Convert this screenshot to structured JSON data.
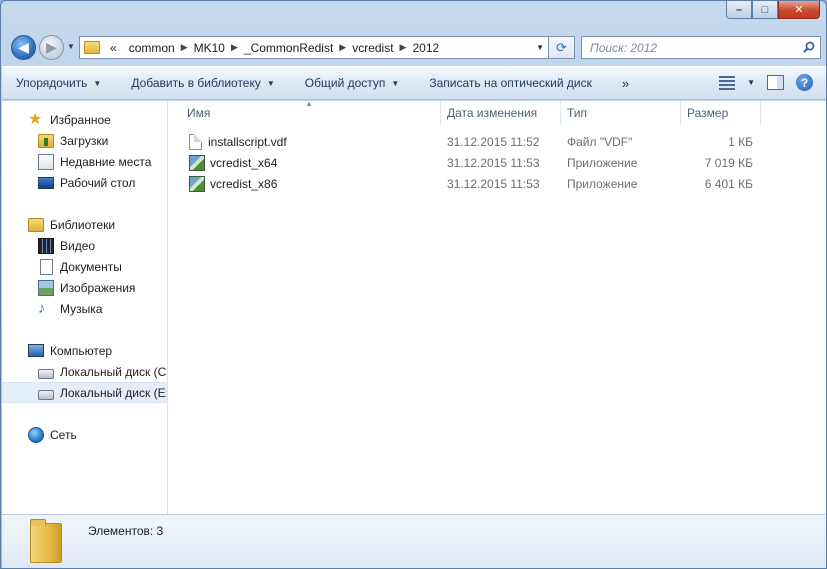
{
  "window": {
    "caption_buttons": {
      "minimize": "–",
      "maximize": "□",
      "close": "✕"
    }
  },
  "address_bar": {
    "overflow": "«",
    "crumbs": [
      "common",
      "MK10",
      "_CommonRedist",
      "vcredist",
      "2012"
    ]
  },
  "search": {
    "placeholder": "Поиск: 2012"
  },
  "toolbar": {
    "organize": "Упорядочить",
    "add_to_library": "Добавить в библиотеку",
    "share": "Общий доступ",
    "burn": "Записать на оптический диск",
    "more": "»",
    "help": "?"
  },
  "nav_pane": {
    "favorites": {
      "label": "Избранное",
      "items": [
        "Загрузки",
        "Недавние места",
        "Рабочий стол"
      ]
    },
    "libraries": {
      "label": "Библиотеки",
      "items": [
        "Видео",
        "Документы",
        "Изображения",
        "Музыка"
      ]
    },
    "computer": {
      "label": "Компьютер",
      "items": [
        "Локальный диск (C:)",
        "Локальный диск (E:)"
      ]
    },
    "network": {
      "label": "Сеть"
    }
  },
  "file_list": {
    "columns": {
      "name": "Имя",
      "date": "Дата изменения",
      "type": "Тип",
      "size": "Размер"
    },
    "rows": [
      {
        "name": "installscript.vdf",
        "date": "31.12.2015 11:52",
        "type": "Файл \"VDF\"",
        "size": "1 КБ",
        "icon": "vdf-file-icon"
      },
      {
        "name": "vcredist_x64",
        "date": "31.12.2015 11:53",
        "type": "Приложение",
        "size": "7 019 КБ",
        "icon": "installer-icon"
      },
      {
        "name": "vcredist_x86",
        "date": "31.12.2015 11:53",
        "type": "Приложение",
        "size": "6 401 КБ",
        "icon": "installer-icon"
      }
    ]
  },
  "status_bar": {
    "text": "Элементов: 3"
  },
  "colors": {
    "accent": "#1e395b",
    "selection": "#e4eef9",
    "column_header": "#4c607a"
  }
}
